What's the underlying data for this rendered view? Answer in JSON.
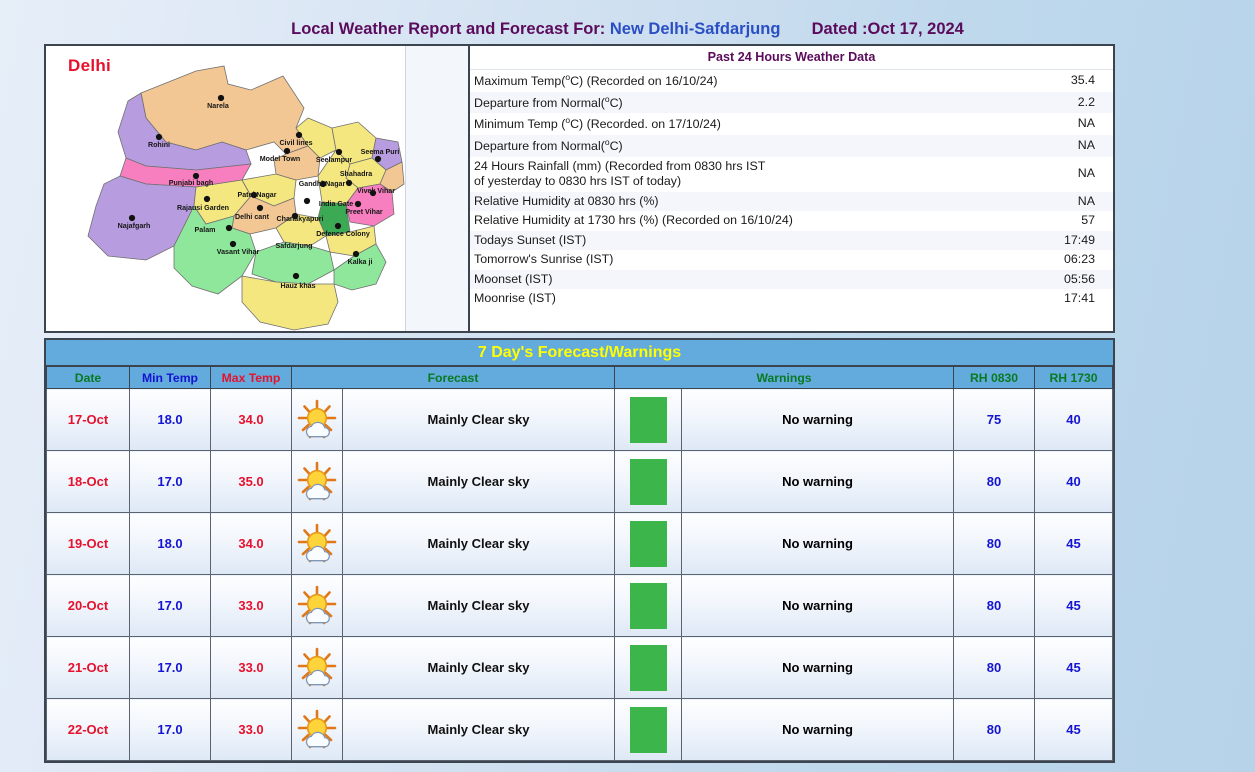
{
  "header": {
    "title_part1": "Local Weather Report and Forecast For:",
    "station": "New Delhi-Safdarjung",
    "dated": "Dated :Oct 17, 2024",
    "color_title": "#5b0b5b",
    "color_station": "#2a4fc4"
  },
  "map": {
    "label": "Delhi",
    "label_color": "#e8112d",
    "locations": [
      "Narela",
      "Rohini",
      "Civil lines",
      "Model Town",
      "Seelampur",
      "Seema Puri",
      "Punjabi bagh",
      "Shahadra",
      "Gandhi Nagar",
      "Vivek Vihar",
      "Patel Nagar",
      "Rajausi Garden",
      "India Gate",
      "Preet Vihar",
      "Delhi cant",
      "Chanakyapuri",
      "Najafgarh",
      "Palam",
      "Defence Colony",
      "Safdarjung",
      "Vasant Vihar",
      "Kalka ji",
      "Hauz khas"
    ],
    "region_colors": {
      "tan": "#f3c793",
      "purple": "#b89ce0",
      "pink": "#f77fc0",
      "yellow": "#f4e77f",
      "green": "#8fe79b",
      "dark_green": "#3caa54"
    }
  },
  "past24": {
    "caption": "Past 24 Hours Weather Data",
    "rows": [
      {
        "label_pre": "Maximum Temp(",
        "label_post": "C) (Recorded on 16/10/24)",
        "value": "35.4"
      },
      {
        "label_pre": "Departure from Normal(",
        "label_post": "C)",
        "value": "2.2"
      },
      {
        "label_pre": "Minimum Temp (",
        "label_post": "C) (Recorded. on 17/10/24)",
        "value": "NA"
      },
      {
        "label_pre": "Departure from Normal(",
        "label_post": "C)",
        "value": "NA"
      },
      {
        "label_line1": "24 Hours Rainfall (mm) (Recorded from 0830 hrs IST",
        "label_line2": "of yesterday to 0830 hrs IST of today)",
        "value": "NA"
      },
      {
        "label_plain": "Relative Humidity at 0830 hrs (%)",
        "value": "NA"
      },
      {
        "label_plain": "Relative Humidity at 1730 hrs (%) (Recorded on 16/10/24)",
        "value": "57"
      },
      {
        "label_plain": "Todays Sunset (IST)",
        "value": "17:49"
      },
      {
        "label_plain": "Tomorrow's Sunrise (IST)",
        "value": "06:23"
      },
      {
        "label_plain": "Moonset (IST)",
        "value": "05:56"
      },
      {
        "label_plain": "Moonrise (IST)",
        "value": "17:41"
      }
    ]
  },
  "forecast": {
    "title": "7 Day's Forecast/Warnings",
    "title_color": "#ffff00",
    "header_bg": "#63aadd",
    "columns": {
      "date": "Date",
      "min_temp": "Min Temp",
      "max_temp": "Max Temp",
      "icon": "",
      "forecast": "Forecast",
      "swatch": "",
      "warnings": "Warnings",
      "rh_0830": "RH 0830",
      "rh_1730": "RH 1730"
    },
    "warning_cell_color": "#137a13",
    "swatch_color": "#3cb54a",
    "rows": [
      {
        "date": "17-Oct",
        "min": "18.0",
        "max": "34.0",
        "icon": "sun-behind-cloud-icon",
        "forecast": "Mainly Clear sky",
        "warning": "No warning",
        "rh0830": "75",
        "rh1730": "40"
      },
      {
        "date": "18-Oct",
        "min": "17.0",
        "max": "35.0",
        "icon": "sun-behind-cloud-icon",
        "forecast": "Mainly Clear sky",
        "warning": "No warning",
        "rh0830": "80",
        "rh1730": "40"
      },
      {
        "date": "19-Oct",
        "min": "18.0",
        "max": "34.0",
        "icon": "sun-behind-cloud-icon",
        "forecast": "Mainly Clear sky",
        "warning": "No warning",
        "rh0830": "80",
        "rh1730": "45"
      },
      {
        "date": "20-Oct",
        "min": "17.0",
        "max": "33.0",
        "icon": "sun-behind-cloud-icon",
        "forecast": "Mainly Clear sky",
        "warning": "No warning",
        "rh0830": "80",
        "rh1730": "45"
      },
      {
        "date": "21-Oct",
        "min": "17.0",
        "max": "33.0",
        "icon": "sun-behind-cloud-icon",
        "forecast": "Mainly Clear sky",
        "warning": "No warning",
        "rh0830": "80",
        "rh1730": "45"
      },
      {
        "date": "22-Oct",
        "min": "17.0",
        "max": "33.0",
        "icon": "sun-behind-cloud-icon",
        "forecast": "Mainly Clear sky",
        "warning": "No warning",
        "rh0830": "80",
        "rh1730": "45"
      }
    ]
  }
}
